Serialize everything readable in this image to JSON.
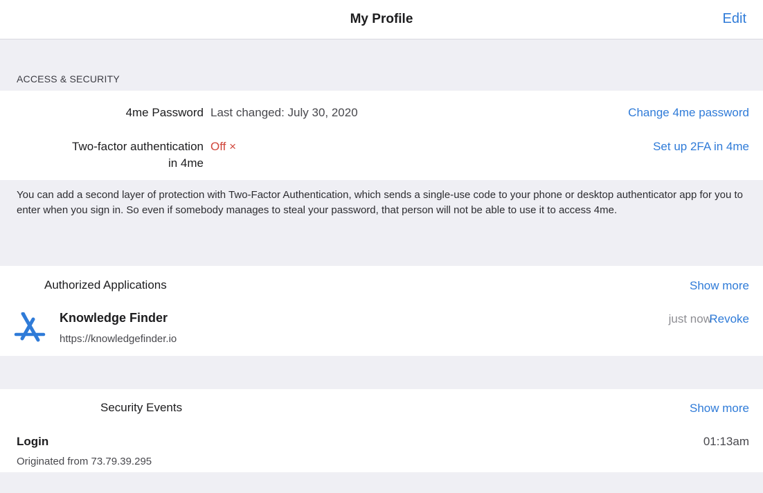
{
  "nav": {
    "title": "My Profile",
    "edit_label": "Edit"
  },
  "access_security": {
    "header": "ACCESS & SECURITY",
    "password": {
      "label": "4me Password",
      "value": "Last changed: July 30, 2020",
      "action": "Change 4me password"
    },
    "two_factor": {
      "label_line1": "Two-factor authentication",
      "label_line2": "in 4me",
      "status": "Off ×",
      "action": "Set up 2FA in 4me"
    },
    "info": "You can add a second layer of protection with Two-Factor Authentication, which sends a single-use code to your phone or desktop authenticator app for you to enter when you sign in. So even if somebody manages to steal your password, that person will not be able to use it to access 4me."
  },
  "authorized_apps": {
    "heading": "Authorized Applications",
    "show_more": "Show more",
    "items": [
      {
        "name": "Knowledge Finder",
        "url": "https://knowledgefinder.io",
        "time": "just now",
        "action": "Revoke",
        "icon": "app-store-icon"
      }
    ]
  },
  "security_events": {
    "heading": "Security Events",
    "show_more": "Show more",
    "items": [
      {
        "title": "Login",
        "detail": "Originated from 73.79.39.295",
        "time": "01:13am"
      }
    ]
  },
  "colors": {
    "accent": "#2f7bd8",
    "danger": "#d0463b",
    "background_gray": "#efeff4"
  }
}
